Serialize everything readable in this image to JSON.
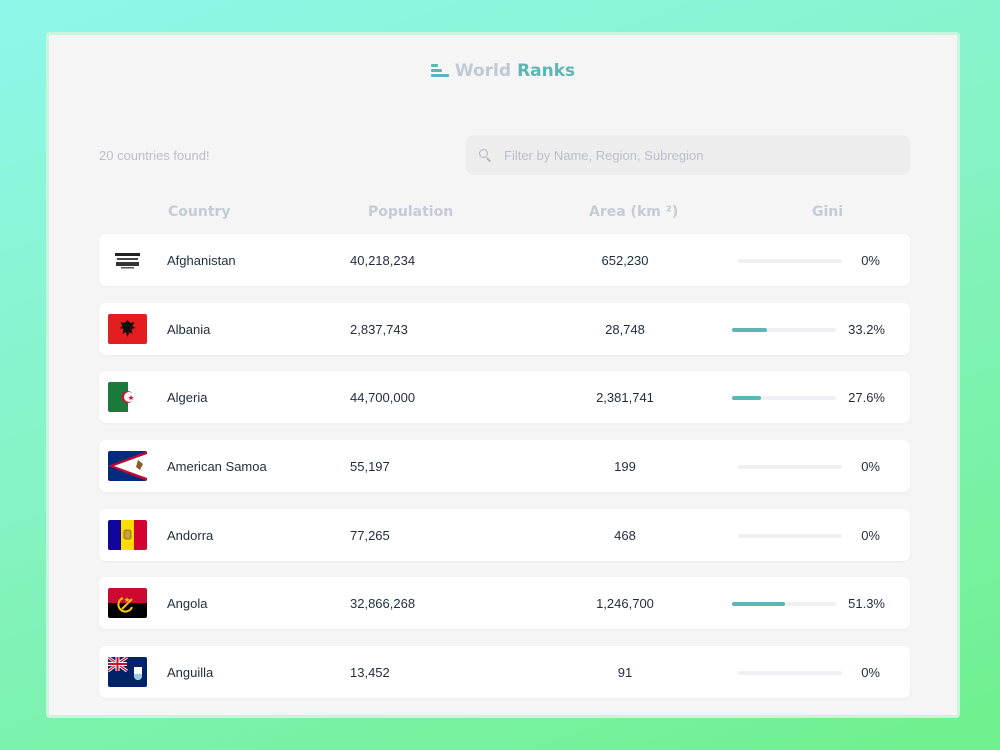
{
  "brand": {
    "part1": "World",
    "part2": "Ranks",
    "logo_icon": "bar-list-icon",
    "accent": "#5bb6b4"
  },
  "summary": {
    "count_text": "20 countries found!"
  },
  "search": {
    "placeholder": "Filter by Name, Region, Subregion",
    "value": "",
    "icon": "search-icon"
  },
  "table": {
    "headers": {
      "country": "Country",
      "population": "Population",
      "area": "Area (km ²)",
      "gini": "Gini"
    },
    "rows": [
      {
        "flag": "afghanistan-flag",
        "name": "Afghanistan",
        "population": "40,218,234",
        "area": "652,230",
        "gini_value": 0,
        "gini_text": "0%"
      },
      {
        "flag": "albania-flag",
        "name": "Albania",
        "population": "2,837,743",
        "area": "28,748",
        "gini_value": 33.2,
        "gini_text": "33.2%"
      },
      {
        "flag": "algeria-flag",
        "name": "Algeria",
        "population": "44,700,000",
        "area": "2,381,741",
        "gini_value": 27.6,
        "gini_text": "27.6%"
      },
      {
        "flag": "american-samoa-flag",
        "name": "American Samoa",
        "population": "55,197",
        "area": "199",
        "gini_value": 0,
        "gini_text": "0%"
      },
      {
        "flag": "andorra-flag",
        "name": "Andorra",
        "population": "77,265",
        "area": "468",
        "gini_value": 0,
        "gini_text": "0%"
      },
      {
        "flag": "angola-flag",
        "name": "Angola",
        "population": "32,866,268",
        "area": "1,246,700",
        "gini_value": 51.3,
        "gini_text": "51.3%"
      },
      {
        "flag": "anguilla-flag",
        "name": "Anguilla",
        "population": "13,452",
        "area": "91",
        "gini_value": 0,
        "gini_text": "0%"
      }
    ]
  }
}
